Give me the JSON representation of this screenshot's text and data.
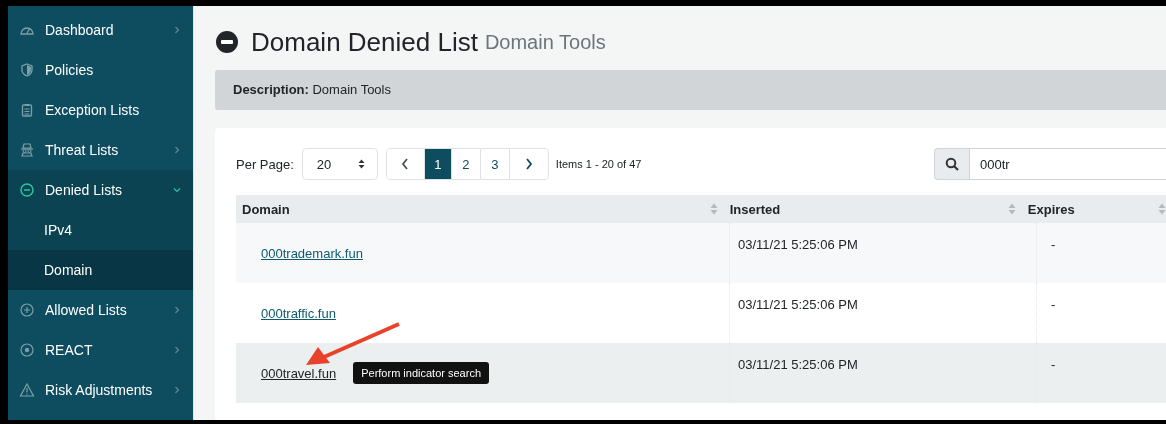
{
  "sidebar": {
    "items": [
      {
        "label": "Dashboard",
        "kind": "group",
        "expanded": false
      },
      {
        "label": "Policies",
        "kind": "link",
        "expanded": false
      },
      {
        "label": "Exception Lists",
        "kind": "link",
        "expanded": false
      },
      {
        "label": "Threat Lists",
        "kind": "group",
        "expanded": false
      },
      {
        "label": "Denied Lists",
        "kind": "group",
        "expanded": true,
        "children": [
          {
            "label": "IPv4",
            "selected": false
          },
          {
            "label": "Domain",
            "selected": true
          }
        ]
      },
      {
        "label": "Allowed Lists",
        "kind": "group",
        "expanded": false
      },
      {
        "label": "REACT",
        "kind": "group",
        "expanded": false
      },
      {
        "label": "Risk Adjustments",
        "kind": "group",
        "expanded": false
      }
    ]
  },
  "page": {
    "title": "Domain Denied List",
    "subtitle": "Domain Tools"
  },
  "description": "**Description:** Domain Tools",
  "toolbar": {
    "per_page_label": "Per Page:",
    "per_page": "20",
    "pages": [
      {
        "label": "1",
        "selected": true
      },
      {
        "label": "2",
        "selected": false
      },
      {
        "label": "3",
        "selected": false
      }
    ],
    "items_info": "Items 1 - 20 of 47",
    "search": {
      "value": "000tr"
    }
  },
  "table": {
    "columns": [
      "Domain",
      "Inserted",
      "Expires"
    ],
    "rows": [
      {
        "domain": "000trademark.fun",
        "inserted": "03/11/21 5:25:06 PM",
        "expires": "-",
        "hovered": false
      },
      {
        "domain": "000traffic.fun",
        "inserted": "03/11/21 5:25:06 PM",
        "expires": "-",
        "hovered": false
      },
      {
        "domain": "000travel.fun",
        "inserted": "03/11/21 5:25:06 PM",
        "expires": "-",
        "hovered": true
      }
    ]
  },
  "tooltip": {
    "text": "Perform indicator search"
  }
}
